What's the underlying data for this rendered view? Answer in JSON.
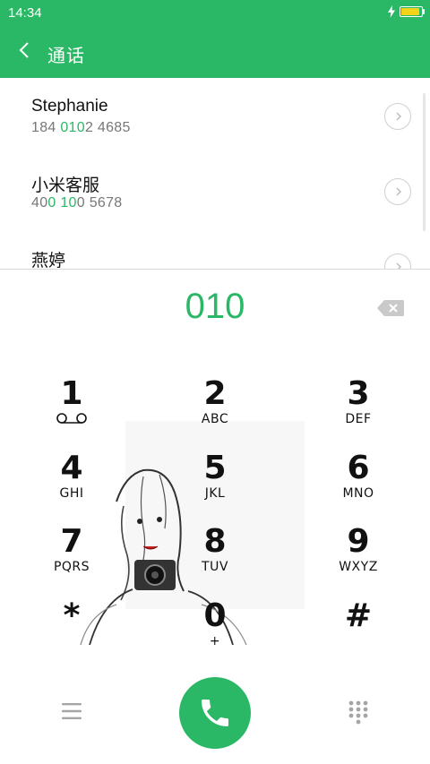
{
  "status_bar": {
    "time": "14:34",
    "battery_level": 0.95
  },
  "header": {
    "title": "通话",
    "back_icon": "chevron-left-icon"
  },
  "results": [
    {
      "name": "Stephanie",
      "number_parts": [
        {
          "text": "184 ",
          "match": false
        },
        {
          "text": "010",
          "match": true
        },
        {
          "text": "2  4685",
          "match": false
        }
      ]
    },
    {
      "name": "小米客服",
      "number_parts": [
        {
          "text": "40",
          "match": false
        },
        {
          "text": "0 10",
          "match": true
        },
        {
          "text": "0  5678",
          "match": false
        }
      ]
    },
    {
      "name": "燕婷",
      "number_parts": []
    }
  ],
  "dialed_number": "010",
  "keypad": [
    {
      "digit": "1",
      "letters": ""
    },
    {
      "digit": "2",
      "letters": "ABC"
    },
    {
      "digit": "3",
      "letters": "DEF"
    },
    {
      "digit": "4",
      "letters": "GHI"
    },
    {
      "digit": "5",
      "letters": "JKL"
    },
    {
      "digit": "6",
      "letters": "MNO"
    },
    {
      "digit": "7",
      "letters": "PQRS"
    },
    {
      "digit": "8",
      "letters": "TUV"
    },
    {
      "digit": "9",
      "letters": "WXYZ"
    },
    {
      "digit": "*",
      "letters": ""
    },
    {
      "digit": "0",
      "letters": "+"
    },
    {
      "digit": "#",
      "letters": ""
    }
  ],
  "icons": {
    "one_key": "voicemail-icon",
    "backspace": "backspace-icon",
    "menu": "menu-icon",
    "call": "phone-icon",
    "dialpad": "dialpad-icon",
    "wallpaper": "sketch-portrait-image"
  },
  "colors": {
    "accent": "#2bb866",
    "battery": "#f3d21a"
  }
}
